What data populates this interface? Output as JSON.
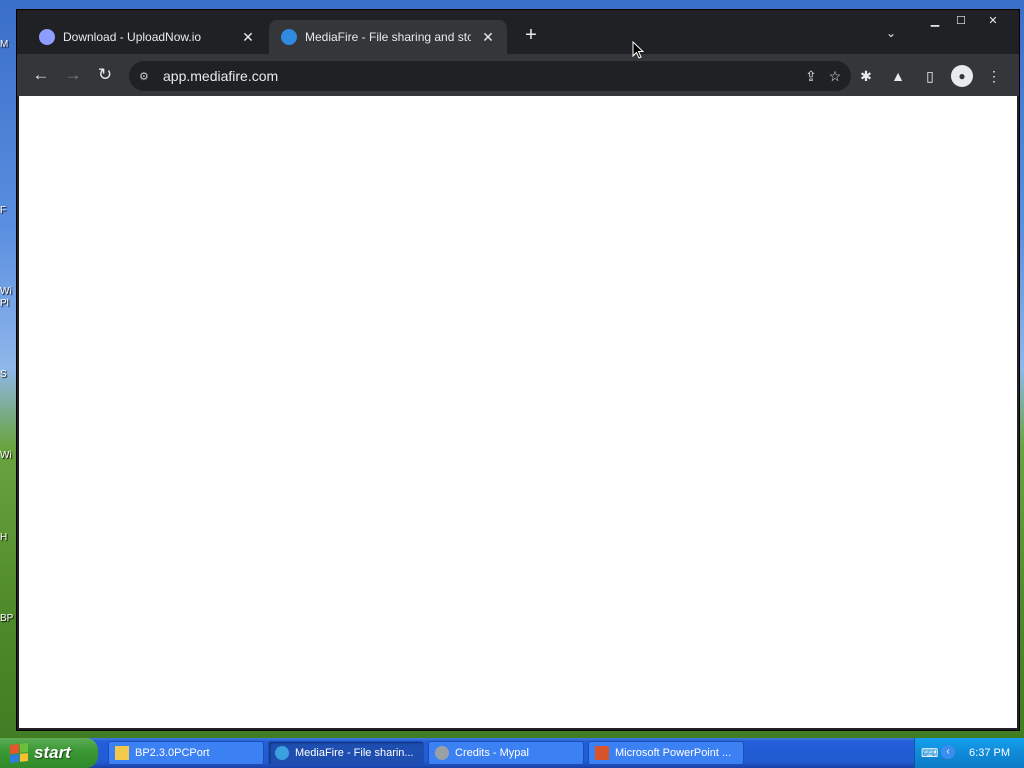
{
  "desktop": {
    "icon_fragments": [
      "M",
      "F",
      "Wi",
      "Pl",
      "S",
      "Wi",
      "H",
      "BP"
    ]
  },
  "browser": {
    "window_controls": {
      "minimize": "▁",
      "maximize": "☐",
      "close": "✕"
    },
    "tabs": [
      {
        "title": "Download - UploadNow.io",
        "favicon_color": "#8c9eff",
        "active": false
      },
      {
        "title": "MediaFire - File sharing and storage",
        "favicon_color": "#2f8ae0",
        "active": true
      }
    ],
    "newtab_glyph": "+",
    "tab_search_glyph": "⌄",
    "toolbar": {
      "back": "←",
      "forward": "→",
      "reload": "↻",
      "site_info_icon": "⚙",
      "url": "app.mediafire.com",
      "share_icon": "⇪",
      "bookmark_icon": "☆",
      "extensions_icon": "✱",
      "labs_icon": "▲",
      "sidepanel_icon": "▯",
      "profile_icon": "●",
      "menu_icon": "⋮"
    }
  },
  "taskbar": {
    "start_label": "start",
    "tasks": [
      {
        "label": "BP2.3.0PCPort",
        "icon_color": "#f2c94c",
        "active": false
      },
      {
        "label": "MediaFire - File sharin...",
        "icon_color": "#3aa0e0",
        "active": true
      },
      {
        "label": "Credits - Mypal",
        "icon_color": "#9aa0a6",
        "active": false
      },
      {
        "label": "Microsoft PowerPoint ...",
        "icon_color": "#d9542b",
        "active": false
      }
    ],
    "tray": {
      "clock": "6:37 PM",
      "keyboard_icon": "⌨",
      "chevron": "‹"
    }
  }
}
